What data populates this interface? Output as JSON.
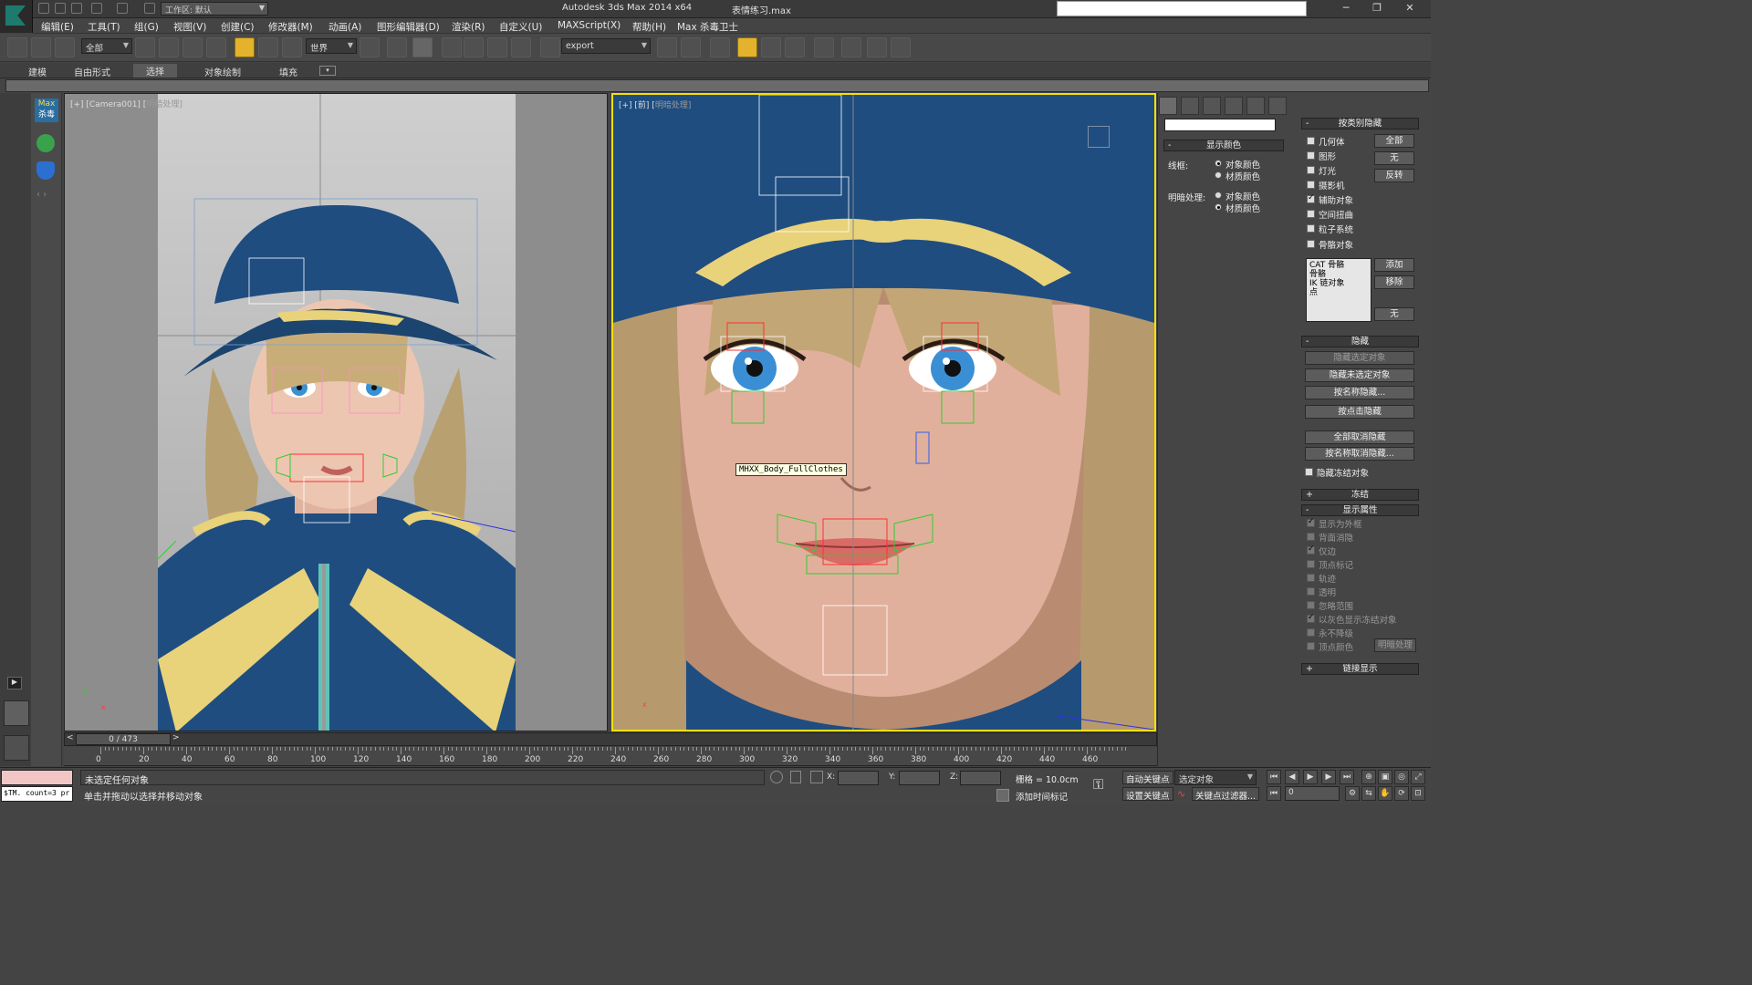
{
  "titlebar": {
    "app_title": "Autodesk 3ds Max  2014 x64",
    "file_name": "表情练习.max",
    "workspace": "工作区: 默认"
  },
  "menubar": {
    "items": [
      "编辑(E)",
      "工具(T)",
      "组(G)",
      "视图(V)",
      "创建(C)",
      "修改器(M)",
      "动画(A)",
      "图形编辑器(D)",
      "渲染(R)",
      "自定义(U)",
      "MAXScript(X)",
      "帮助(H)",
      "Max 杀毒卫士"
    ]
  },
  "toolbar": {
    "selection_filter": "全部",
    "ref_coord": "世界",
    "named_selection": "export"
  },
  "ribbon": {
    "tabs": [
      "建模",
      "自由形式",
      "选择",
      "对象绘制",
      "填充"
    ],
    "selected": "选择"
  },
  "leftstrip": {
    "logo_line1": "Max",
    "logo_line2": "杀毒"
  },
  "viewports": {
    "left": {
      "label_a": "[+] [Camera001] [",
      "label_b": "明暗处理",
      "label_c": "]"
    },
    "right": {
      "label_a": "[+] [前] [",
      "label_b": "明暗处理",
      "label_c": "]"
    },
    "tooltip": "MHXX_Body_FullClothes"
  },
  "display_color": {
    "header": "显示颜色",
    "wire_label": "线框:",
    "shaded_label": "明暗处理:",
    "opt_object": "对象颜色",
    "opt_material": "材质颜色"
  },
  "hide_by_category": {
    "header": "按类别隐藏",
    "items": [
      "几何体",
      "图形",
      "灯光",
      "摄影机",
      "辅助对象",
      "空间扭曲",
      "粒子系统",
      "骨骼对象"
    ],
    "checked": [
      false,
      false,
      false,
      false,
      true,
      false,
      false,
      false
    ],
    "btn_all": "全部",
    "btn_none": "无",
    "btn_invert": "反转",
    "list": [
      "CAT 骨骼",
      "骨骼",
      "IK 链对象",
      "点"
    ],
    "btn_add": "添加",
    "btn_remove": "移除",
    "btn_none2": "无"
  },
  "hide": {
    "header": "隐藏",
    "buttons": [
      "隐藏选定对象",
      "隐藏未选定对象",
      "按名称隐藏...",
      "按点击隐藏",
      "全部取消隐藏",
      "按名称取消隐藏...",
      ""
    ],
    "hide_frozen": "隐藏冻结对象"
  },
  "freeze": {
    "header": "冻结"
  },
  "display_props": {
    "header": "显示属性",
    "items": [
      "显示为外框",
      "背面消隐",
      "仅边",
      "顶点标记",
      "轨迹",
      "透明",
      "忽略范围",
      "以灰色显示冻结对象",
      "永不降级",
      "顶点颜色"
    ],
    "checked": [
      true,
      false,
      true,
      false,
      false,
      false,
      false,
      true,
      false,
      false
    ],
    "shaded_btn": "明暗处理"
  },
  "link_display": {
    "header": "链接显示"
  },
  "timeline": {
    "slider": "0 / 473",
    "ticks": [
      "0",
      "20",
      "40",
      "60",
      "80",
      "100",
      "120",
      "140",
      "160",
      "180",
      "200",
      "220",
      "240",
      "260",
      "280",
      "300",
      "320",
      "340",
      "360",
      "380",
      "400",
      "420",
      "440",
      "460"
    ]
  },
  "status": {
    "line1": "未选定任何对象",
    "line2": "单击并拖动以选择并移动对象",
    "x_label": "X:",
    "y_label": "Y:",
    "z_label": "Z:",
    "grid": "栅格 = 10.0cm",
    "add_time_tag": "添加时间标记",
    "auto_key": "自动关键点",
    "set_key": "设置关键点",
    "selected_obj": "选定对象",
    "key_filters": "关键点过滤器...",
    "frame": "0",
    "maxscript_out": "$TM. count=3 pr"
  }
}
